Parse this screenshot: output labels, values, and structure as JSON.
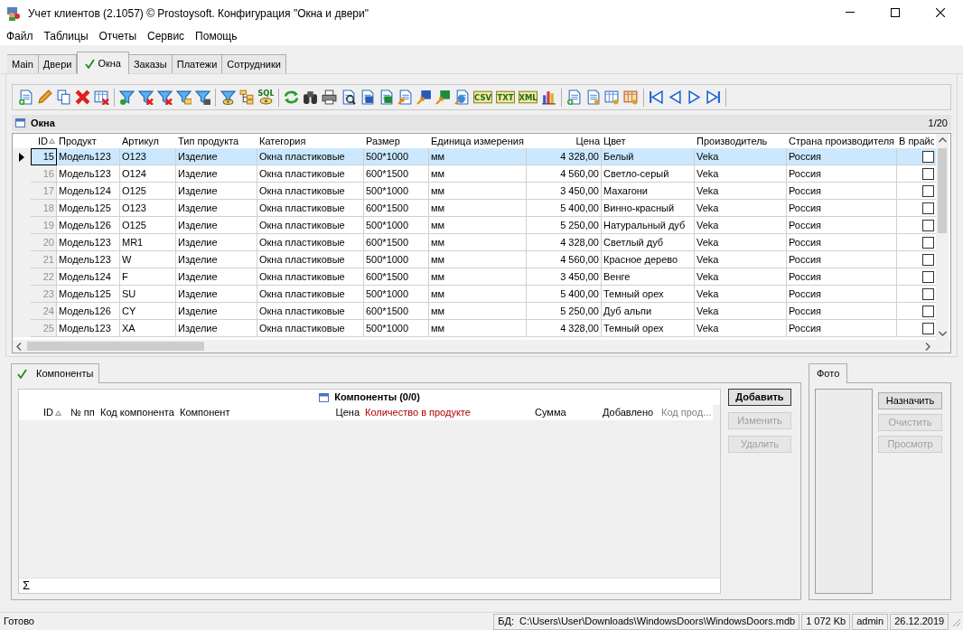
{
  "window": {
    "title": "Учет клиентов (2.1057) © Prostoysoft. Конфигурация \"Окна и двери\""
  },
  "menu": [
    "Файл",
    "Таблицы",
    "Отчеты",
    "Сервис",
    "Помощь"
  ],
  "tabs": [
    {
      "label": "Main",
      "selected": false,
      "checked": false
    },
    {
      "label": "Двери",
      "selected": false,
      "checked": false
    },
    {
      "label": "Окна",
      "selected": true,
      "checked": true
    },
    {
      "label": "Заказы",
      "selected": false,
      "checked": false
    },
    {
      "label": "Платежи",
      "selected": false,
      "checked": false
    },
    {
      "label": "Сотрудники",
      "selected": false,
      "checked": false
    }
  ],
  "toolbar": {
    "icon_labels": [
      "SQL",
      "CSV",
      "TXT",
      "XML"
    ]
  },
  "table": {
    "title": "Окна",
    "position": "1/20",
    "columns": [
      {
        "label": "ID",
        "sorted": true,
        "kind": "number"
      },
      {
        "label": "Продукт",
        "sorted": false,
        "kind": "text"
      },
      {
        "label": "Артикул",
        "sorted": false,
        "kind": "text"
      },
      {
        "label": "Тип продукта",
        "sorted": false,
        "kind": "text"
      },
      {
        "label": "Категория",
        "sorted": false,
        "kind": "text"
      },
      {
        "label": "Размер",
        "sorted": false,
        "kind": "text"
      },
      {
        "label": "Единица измерения",
        "sorted": false,
        "kind": "text"
      },
      {
        "label": "Цена",
        "sorted": false,
        "kind": "number"
      },
      {
        "label": "Цвет",
        "sorted": false,
        "kind": "text"
      },
      {
        "label": "Производитель",
        "sorted": false,
        "kind": "text"
      },
      {
        "label": "Страна производителя",
        "sorted": false,
        "kind": "text"
      },
      {
        "label": "В прайс",
        "sorted": false,
        "kind": "checkbox"
      }
    ],
    "rows": [
      {
        "selected": true,
        "cells": [
          "15",
          "Модель123",
          "O123",
          "Изделие",
          "Окна пластиковые",
          "500*1000",
          "мм",
          "4 328,00",
          "Белый",
          "Veka",
          "Россия"
        ],
        "in_price": false
      },
      {
        "selected": false,
        "cells": [
          "16",
          "Модель123",
          "O124",
          "Изделие",
          "Окна пластиковые",
          "600*1500",
          "мм",
          "4 560,00",
          "Светло-серый",
          "Veka",
          "Россия"
        ],
        "in_price": false
      },
      {
        "selected": false,
        "cells": [
          "17",
          "Модель124",
          "O125",
          "Изделие",
          "Окна пластиковые",
          "500*1000",
          "мм",
          "3 450,00",
          "Махагони",
          "Veka",
          "Россия"
        ],
        "in_price": false
      },
      {
        "selected": false,
        "cells": [
          "18",
          "Модель125",
          "O123",
          "Изделие",
          "Окна пластиковые",
          "600*1500",
          "мм",
          "5 400,00",
          "Винно-красный",
          "Veka",
          "Россия"
        ],
        "in_price": false
      },
      {
        "selected": false,
        "cells": [
          "19",
          "Модель126",
          "O125",
          "Изделие",
          "Окна пластиковые",
          "500*1000",
          "мм",
          "5 250,00",
          "Натуральный дуб",
          "Veka",
          "Россия"
        ],
        "in_price": false
      },
      {
        "selected": false,
        "cells": [
          "20",
          "Модель123",
          "MR1",
          "Изделие",
          "Окна пластиковые",
          "600*1500",
          "мм",
          "4 328,00",
          "Светлый дуб",
          "Veka",
          "Россия"
        ],
        "in_price": false
      },
      {
        "selected": false,
        "cells": [
          "21",
          "Модель123",
          "W",
          "Изделие",
          "Окна пластиковые",
          "500*1000",
          "мм",
          "4 560,00",
          "Красное дерево",
          "Veka",
          "Россия"
        ],
        "in_price": false
      },
      {
        "selected": false,
        "cells": [
          "22",
          "Модель124",
          "F",
          "Изделие",
          "Окна пластиковые",
          "600*1500",
          "мм",
          "3 450,00",
          "Венге",
          "Veka",
          "Россия"
        ],
        "in_price": false
      },
      {
        "selected": false,
        "cells": [
          "23",
          "Модель125",
          "SU",
          "Изделие",
          "Окна пластиковые",
          "500*1000",
          "мм",
          "5 400,00",
          "Темный орех",
          "Veka",
          "Россия"
        ],
        "in_price": false
      },
      {
        "selected": false,
        "cells": [
          "24",
          "Модель126",
          "CY",
          "Изделие",
          "Окна пластиковые",
          "600*1500",
          "мм",
          "5 250,00",
          "Дуб альпи",
          "Veka",
          "Россия"
        ],
        "in_price": false
      },
      {
        "selected": false,
        "cells": [
          "25",
          "Модель123",
          "XA",
          "Изделие",
          "Окна пластиковые",
          "500*1000",
          "мм",
          "4 328,00",
          "Темный орех",
          "Veka",
          "Россия"
        ],
        "in_price": false
      }
    ]
  },
  "components": {
    "tab": {
      "label": "Компоненты",
      "checked": true,
      "selected": true
    },
    "title": "Компоненты (0/0)",
    "columns": [
      {
        "label": "ID",
        "sorted": true
      },
      {
        "label": "№ пп",
        "sorted": false
      },
      {
        "label": "Код компонента",
        "sorted": false
      },
      {
        "label": "Компонент",
        "sorted": false
      },
      {
        "label": "Цена",
        "sorted": false
      },
      {
        "label": "Количество в продукте",
        "sorted": false,
        "color": "#b00000"
      },
      {
        "label": "Сумма",
        "sorted": false
      },
      {
        "label": "Добавлено",
        "sorted": false
      },
      {
        "label": "Код прод...",
        "sorted": false,
        "color": "#808080"
      }
    ],
    "footer": "Σ",
    "buttons": [
      {
        "label": "Добавить",
        "disabled": false,
        "default": true
      },
      {
        "label": "Изменить",
        "disabled": true,
        "default": false
      },
      {
        "label": "Удалить",
        "disabled": true,
        "default": false
      }
    ]
  },
  "photo": {
    "tab": {
      "label": "Фото",
      "selected": true
    },
    "buttons": [
      {
        "label": "Назначить",
        "disabled": false
      },
      {
        "label": "Очистить",
        "disabled": true
      },
      {
        "label": "Просмотр",
        "disabled": true
      }
    ]
  },
  "status_bar": {
    "text": "Готово",
    "db_label": "БД:",
    "db_path": "C:\\Users\\User\\Downloads\\WindowsDoors\\WindowsDoors.mdb",
    "size": "1 072 Kb",
    "user": "admin",
    "date": "26.12.2019"
  }
}
